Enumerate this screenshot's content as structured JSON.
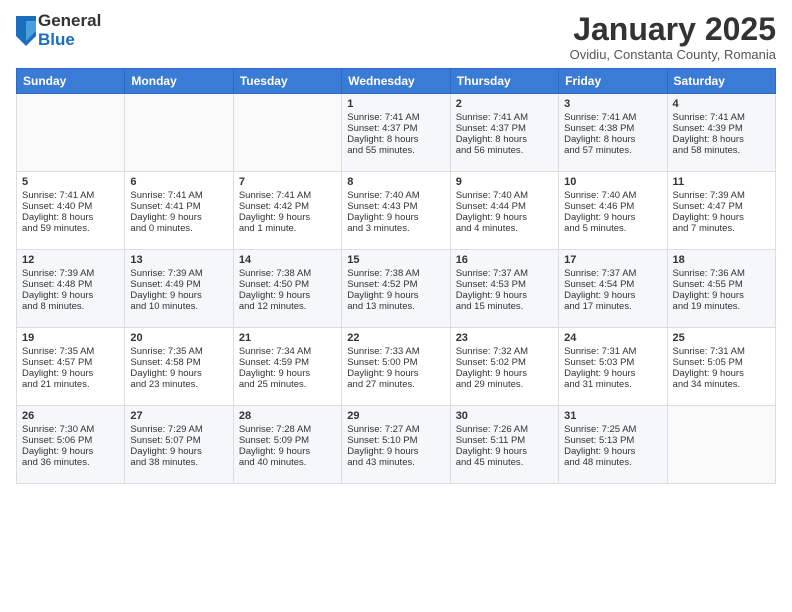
{
  "logo": {
    "general": "General",
    "blue": "Blue"
  },
  "title": "January 2025",
  "location": "Ovidiu, Constanta County, Romania",
  "days_of_week": [
    "Sunday",
    "Monday",
    "Tuesday",
    "Wednesday",
    "Thursday",
    "Friday",
    "Saturday"
  ],
  "weeks": [
    [
      {
        "day": "",
        "content": ""
      },
      {
        "day": "",
        "content": ""
      },
      {
        "day": "",
        "content": ""
      },
      {
        "day": "1",
        "content": "Sunrise: 7:41 AM\nSunset: 4:37 PM\nDaylight: 8 hours\nand 55 minutes."
      },
      {
        "day": "2",
        "content": "Sunrise: 7:41 AM\nSunset: 4:37 PM\nDaylight: 8 hours\nand 56 minutes."
      },
      {
        "day": "3",
        "content": "Sunrise: 7:41 AM\nSunset: 4:38 PM\nDaylight: 8 hours\nand 57 minutes."
      },
      {
        "day": "4",
        "content": "Sunrise: 7:41 AM\nSunset: 4:39 PM\nDaylight: 8 hours\nand 58 minutes."
      }
    ],
    [
      {
        "day": "5",
        "content": "Sunrise: 7:41 AM\nSunset: 4:40 PM\nDaylight: 8 hours\nand 59 minutes."
      },
      {
        "day": "6",
        "content": "Sunrise: 7:41 AM\nSunset: 4:41 PM\nDaylight: 9 hours\nand 0 minutes."
      },
      {
        "day": "7",
        "content": "Sunrise: 7:41 AM\nSunset: 4:42 PM\nDaylight: 9 hours\nand 1 minute."
      },
      {
        "day": "8",
        "content": "Sunrise: 7:40 AM\nSunset: 4:43 PM\nDaylight: 9 hours\nand 3 minutes."
      },
      {
        "day": "9",
        "content": "Sunrise: 7:40 AM\nSunset: 4:44 PM\nDaylight: 9 hours\nand 4 minutes."
      },
      {
        "day": "10",
        "content": "Sunrise: 7:40 AM\nSunset: 4:46 PM\nDaylight: 9 hours\nand 5 minutes."
      },
      {
        "day": "11",
        "content": "Sunrise: 7:39 AM\nSunset: 4:47 PM\nDaylight: 9 hours\nand 7 minutes."
      }
    ],
    [
      {
        "day": "12",
        "content": "Sunrise: 7:39 AM\nSunset: 4:48 PM\nDaylight: 9 hours\nand 8 minutes."
      },
      {
        "day": "13",
        "content": "Sunrise: 7:39 AM\nSunset: 4:49 PM\nDaylight: 9 hours\nand 10 minutes."
      },
      {
        "day": "14",
        "content": "Sunrise: 7:38 AM\nSunset: 4:50 PM\nDaylight: 9 hours\nand 12 minutes."
      },
      {
        "day": "15",
        "content": "Sunrise: 7:38 AM\nSunset: 4:52 PM\nDaylight: 9 hours\nand 13 minutes."
      },
      {
        "day": "16",
        "content": "Sunrise: 7:37 AM\nSunset: 4:53 PM\nDaylight: 9 hours\nand 15 minutes."
      },
      {
        "day": "17",
        "content": "Sunrise: 7:37 AM\nSunset: 4:54 PM\nDaylight: 9 hours\nand 17 minutes."
      },
      {
        "day": "18",
        "content": "Sunrise: 7:36 AM\nSunset: 4:55 PM\nDaylight: 9 hours\nand 19 minutes."
      }
    ],
    [
      {
        "day": "19",
        "content": "Sunrise: 7:35 AM\nSunset: 4:57 PM\nDaylight: 9 hours\nand 21 minutes."
      },
      {
        "day": "20",
        "content": "Sunrise: 7:35 AM\nSunset: 4:58 PM\nDaylight: 9 hours\nand 23 minutes."
      },
      {
        "day": "21",
        "content": "Sunrise: 7:34 AM\nSunset: 4:59 PM\nDaylight: 9 hours\nand 25 minutes."
      },
      {
        "day": "22",
        "content": "Sunrise: 7:33 AM\nSunset: 5:00 PM\nDaylight: 9 hours\nand 27 minutes."
      },
      {
        "day": "23",
        "content": "Sunrise: 7:32 AM\nSunset: 5:02 PM\nDaylight: 9 hours\nand 29 minutes."
      },
      {
        "day": "24",
        "content": "Sunrise: 7:31 AM\nSunset: 5:03 PM\nDaylight: 9 hours\nand 31 minutes."
      },
      {
        "day": "25",
        "content": "Sunrise: 7:31 AM\nSunset: 5:05 PM\nDaylight: 9 hours\nand 34 minutes."
      }
    ],
    [
      {
        "day": "26",
        "content": "Sunrise: 7:30 AM\nSunset: 5:06 PM\nDaylight: 9 hours\nand 36 minutes."
      },
      {
        "day": "27",
        "content": "Sunrise: 7:29 AM\nSunset: 5:07 PM\nDaylight: 9 hours\nand 38 minutes."
      },
      {
        "day": "28",
        "content": "Sunrise: 7:28 AM\nSunset: 5:09 PM\nDaylight: 9 hours\nand 40 minutes."
      },
      {
        "day": "29",
        "content": "Sunrise: 7:27 AM\nSunset: 5:10 PM\nDaylight: 9 hours\nand 43 minutes."
      },
      {
        "day": "30",
        "content": "Sunrise: 7:26 AM\nSunset: 5:11 PM\nDaylight: 9 hours\nand 45 minutes."
      },
      {
        "day": "31",
        "content": "Sunrise: 7:25 AM\nSunset: 5:13 PM\nDaylight: 9 hours\nand 48 minutes."
      },
      {
        "day": "",
        "content": ""
      }
    ]
  ]
}
